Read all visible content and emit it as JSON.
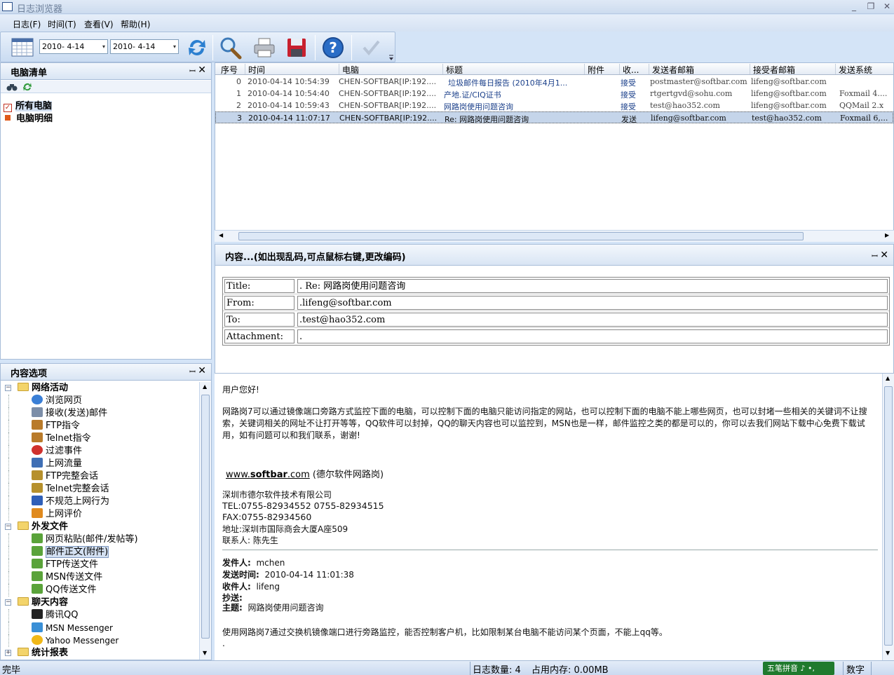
{
  "window": {
    "title": "日志浏览器",
    "min": "_",
    "restore": "❐",
    "close": "✕"
  },
  "menu": [
    "日志(F)",
    "时间(T)",
    "查看(V)",
    "帮助(H)"
  ],
  "toolbar": {
    "date_from": "2010- 4-14",
    "date_to": "2010- 4-14",
    "dropdown_arrow": "▾"
  },
  "left_top": {
    "title": "电脑清单",
    "pin": "ꟷ",
    "close": "✕",
    "items": [
      "所有电脑",
      "电脑明细"
    ]
  },
  "left_bottom": {
    "title": "内容选项",
    "tree": [
      {
        "label": "网络活动",
        "type": "group"
      },
      {
        "label": "浏览网页",
        "icon": "browser-icon",
        "color": "#3a7fd6"
      },
      {
        "label": "接收(发送)邮件",
        "icon": "mail-icon",
        "color": "#7c8ea8"
      },
      {
        "label": "FTP指令",
        "icon": "user-icon",
        "color": "#b97b2a"
      },
      {
        "label": "Telnet指令",
        "icon": "user-icon",
        "color": "#b97b2a"
      },
      {
        "label": "过滤事件",
        "icon": "stop-icon",
        "color": "#d0312d"
      },
      {
        "label": "上网流量",
        "icon": "graph-icon",
        "color": "#3f6fb5"
      },
      {
        "label": "FTP完整会话",
        "icon": "session-icon",
        "color": "#b6902c"
      },
      {
        "label": "Telnet完整会话",
        "icon": "session-icon",
        "color": "#b6902c"
      },
      {
        "label": "不规范上网行为",
        "icon": "diamond-icon",
        "color": "#2f5fb8"
      },
      {
        "label": "上网评价",
        "icon": "check-icon",
        "color": "#e08a1e"
      },
      {
        "label": "外发文件",
        "type": "group"
      },
      {
        "label": "网页粘贴(邮件/发帖等)",
        "icon": "file-out-icon",
        "color": "#5aa33a"
      },
      {
        "label": "邮件正文(附件)",
        "icon": "file-out-icon",
        "color": "#5aa33a",
        "selected": true
      },
      {
        "label": "FTP传送文件",
        "icon": "file-out-icon",
        "color": "#5aa33a"
      },
      {
        "label": "MSN传送文件",
        "icon": "file-out-icon",
        "color": "#5aa33a"
      },
      {
        "label": "QQ传送文件",
        "icon": "file-out-icon",
        "color": "#5aa33a"
      },
      {
        "label": "聊天内容",
        "type": "group"
      },
      {
        "label": "腾讯QQ",
        "icon": "qq-icon",
        "color": "#222222"
      },
      {
        "label": "MSN Messenger",
        "icon": "msn-icon",
        "color": "#3a8fd6"
      },
      {
        "label": "Yahoo Messenger",
        "icon": "yahoo-icon",
        "color": "#f0b818"
      },
      {
        "label": "统计报表",
        "type": "group"
      }
    ]
  },
  "grid": {
    "columns": [
      "序号",
      "时间",
      "电脑",
      "标题",
      "附件",
      "收...",
      "发送者邮箱",
      "接受者邮箱",
      "发送系统"
    ],
    "rows": [
      {
        "no": "0",
        "time": "2010-04-14 10:54:39",
        "pc": "CHEN-SOFTBAR[IP:192....",
        "title": "垃圾邮件每日报告 (2010年4月1...",
        "att": "",
        "dir": "接受",
        "from": "postmaster@softbar.com",
        "to": "lifeng@softbar.com",
        "sys": ""
      },
      {
        "no": "1",
        "time": "2010-04-14 10:54:40",
        "pc": "CHEN-SOFTBAR[IP:192....",
        "title": "产地.证/CIQ证书",
        "att": "",
        "dir": "接受",
        "from": "rtgertgvd@sohu.com",
        "to": "lifeng@softbar.com",
        "sys": "Foxmail 4...."
      },
      {
        "no": "2",
        "time": "2010-04-14 10:59:43",
        "pc": "CHEN-SOFTBAR[IP:192....",
        "title": "网路岗使用问题咨询",
        "att": "",
        "dir": "接受",
        "from": "test@hao352.com",
        "to": "lifeng@softbar.com",
        "sys": "QQMail 2.x"
      },
      {
        "no": "3",
        "time": "2010-04-14 11:07:17",
        "pc": "CHEN-SOFTBAR[IP:192....",
        "title": "Re: 网路岗使用问题咨询",
        "att": "",
        "dir": "发送",
        "from": "lifeng@softbar.com",
        "to": "test@hao352.com",
        "sys": "Foxmail 6,..."
      }
    ]
  },
  "content": {
    "title": "内容...(如出现乱码,可点鼠标右键,更改编码)",
    "header_rows": [
      {
        "k": "Title:",
        "v": ". Re: 网路岗使用问题咨询"
      },
      {
        "k": "From:",
        "v": ".lifeng@softbar.com"
      },
      {
        "k": "To:",
        "v": ".test@hao352.com"
      },
      {
        "k": "Attachment:",
        "v": "."
      }
    ],
    "body": {
      "greeting": "用户您好!",
      "para": "网路岗7可以通过镜像端口旁路方式监控下面的电脑，可以控制下面的电脑只能访问指定的网站，也可以控制下面的电脑不能上哪些网页，也可以封堵一些相关的关键词不让搜索，关键词相关的网址不让打开等等，QQ软件可以封掉，QQ的聊天内容也可以监控到，MSN也是一样，邮件监控之类的都是可以的，你可以去我们网站下载中心免费下载试用，如有问题可以和我们联系，谢谢!",
      "site_prefix": "www.",
      "site_bold": "softbar",
      "site_suffix": ".com",
      "site_note": "(德尔软件网路岗)",
      "company": "深圳市德尔软件技术有限公司",
      "tel": "TEL:0755-82934552  0755-82934515",
      "fax": "FAX:0755-82934560",
      "addr": "地址:深圳市国际商会大厦A座509",
      "contact": "联系人: 陈先生",
      "from_lbl": "发件人:",
      "from_val": "mchen",
      "time_lbl": "发送时间:",
      "time_val": "2010-04-14 11:01:38",
      "to_lbl": "收件人:",
      "to_val": "lifeng",
      "cc_lbl": "抄送:",
      "subj_lbl": "主题:",
      "subj_val": "网路岗使用问题咨询",
      "quoted": "使用网路岗7通过交换机镜像端口进行旁路监控，能否控制客户机，比如限制某台电脑不能访问某个页面，不能上qq等。",
      "dot": "."
    }
  },
  "status": {
    "left": "完毕",
    "log_count": "日志数量: 4",
    "memory": "占用内存: 0.00MB",
    "ime": "五笔拼音",
    "ime_extra": "♪ •,",
    "num": "数字"
  }
}
